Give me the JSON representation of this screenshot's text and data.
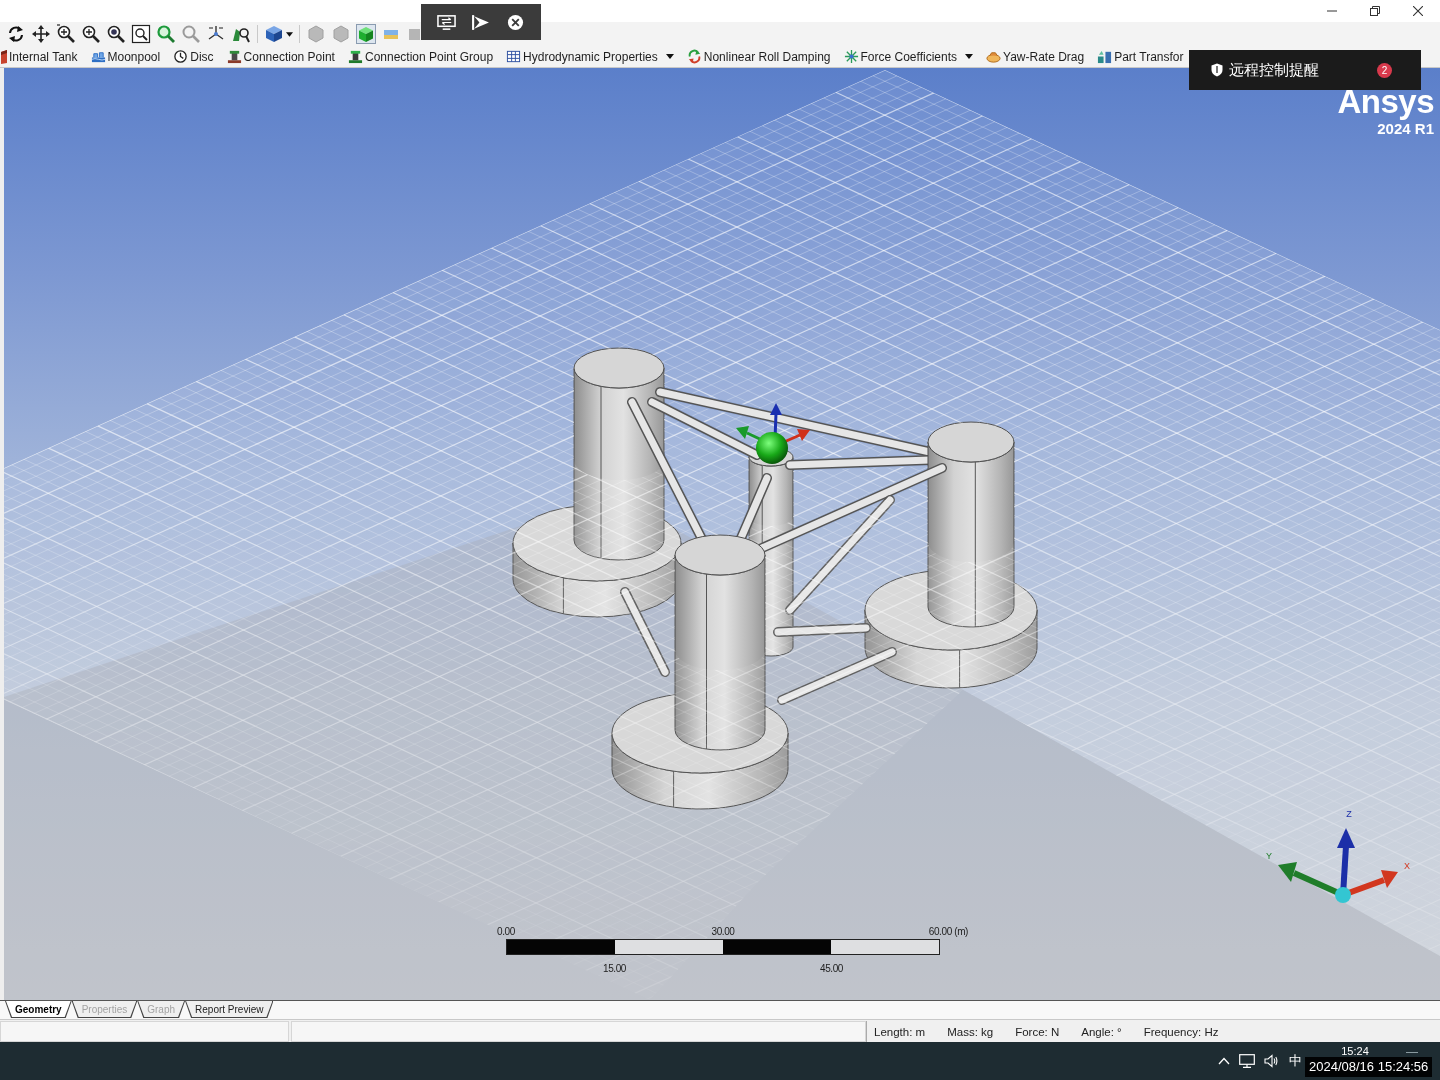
{
  "toolbar": {
    "groups": [
      {
        "buttons": [
          {
            "kind": "rotate",
            "selected": false
          },
          {
            "kind": "pan",
            "selected": false
          },
          {
            "kind": "zoom",
            "selected": false
          },
          {
            "kind": "zoomin",
            "selected": false
          },
          {
            "kind": "zoomarea",
            "selected": false
          },
          {
            "kind": "zoombox",
            "selected": false
          },
          {
            "kind": "fit",
            "selected": false
          },
          {
            "kind": "zoomprev",
            "selected": false
          },
          {
            "kind": "iso",
            "selected": false
          },
          {
            "kind": "view",
            "selected": false
          }
        ]
      },
      {
        "buttons": [
          {
            "kind": "cube",
            "selected": false
          }
        ]
      },
      {
        "buttons": [
          {
            "kind": "hexagon",
            "selected": false
          },
          {
            "kind": "hexagon",
            "selected": false
          },
          {
            "kind": "solid",
            "selected": true
          },
          {
            "kind": "water",
            "selected": false
          },
          {
            "kind": "panel",
            "selected": false
          }
        ]
      }
    ]
  },
  "feature_bar": {
    "items": [
      {
        "kind": "tank",
        "label": "Internal Tank",
        "dropdown": false
      },
      {
        "kind": "pool",
        "label": "Moonpool",
        "dropdown": false
      },
      {
        "kind": "disc",
        "label": "Disc",
        "dropdown": false
      },
      {
        "kind": "point",
        "label": "Connection Point",
        "dropdown": false
      },
      {
        "kind": "group",
        "label": "Connection Point Group",
        "dropdown": false
      },
      {
        "kind": "hydro",
        "label": "Hydrodynamic Properties",
        "dropdown": true
      },
      {
        "kind": "damping",
        "label": "Nonlinear Roll Damping",
        "dropdown": false
      },
      {
        "kind": "force",
        "label": "Force Coefficients",
        "dropdown": true
      },
      {
        "kind": "drag",
        "label": "Yaw-Rate Drag",
        "dropdown": false
      },
      {
        "kind": "transform",
        "label": "Part Transfor",
        "dropdown": false
      }
    ]
  },
  "notification": {
    "title": "远程控制提醒",
    "count": "2"
  },
  "viewport": {
    "logo": {
      "name": "Ansys",
      "version": "2024 R1"
    },
    "scale_bar": {
      "top_labels": [
        "0.00",
        "30.00",
        "60.00 (m)"
      ],
      "bottom_labels": [
        "15.00",
        "45.00"
      ]
    },
    "axis_triad": {
      "axes": [
        {
          "kind": "z",
          "label": "Z",
          "color": "#1c2fa8"
        },
        {
          "kind": "y",
          "label": "Y",
          "color": "#1f7d2a"
        },
        {
          "kind": "x",
          "label": "X",
          "color": "#d2371f"
        }
      ]
    }
  },
  "bottom_tabs": [
    {
      "label": "Geometry",
      "selected": true,
      "disabled": false
    },
    {
      "label": "Properties",
      "selected": false,
      "disabled": true
    },
    {
      "label": "Graph",
      "selected": false,
      "disabled": true
    },
    {
      "label": "Report Preview",
      "selected": false,
      "disabled": false
    }
  ],
  "status_bar": {
    "units": [
      "Length: m",
      "Mass: kg",
      "Force: N",
      "Angle: °",
      "Frequency: Hz"
    ]
  },
  "taskbar": {
    "ime": "中",
    "clock": "15:24",
    "recording_timestamp": "2024/08/16 15:24:56"
  }
}
